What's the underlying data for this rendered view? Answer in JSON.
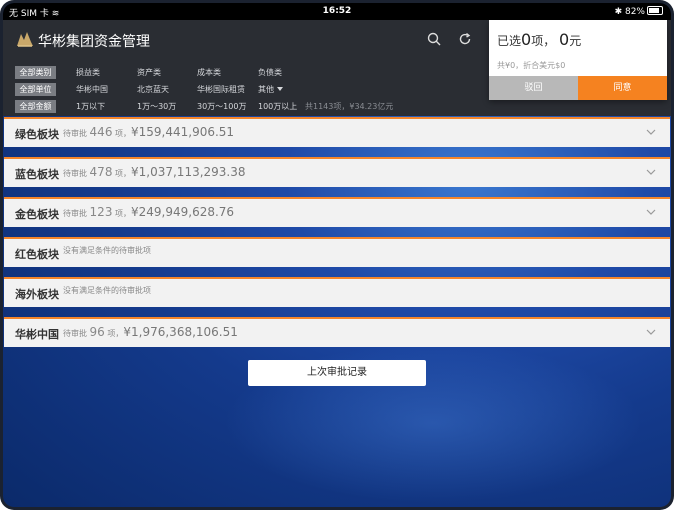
{
  "statusbar": {
    "carrier": "无 SIM 卡",
    "time": "16:52",
    "battery": "82%"
  },
  "header": {
    "title": "华彬集团资金管理"
  },
  "filters": {
    "row1": {
      "chip": "全部类别",
      "options": [
        "损益类",
        "资产类",
        "成本类",
        "负债类"
      ]
    },
    "row2": {
      "chip": "全部单位",
      "options": [
        "华彬中国",
        "北京蓝天",
        "华彬国际租赁",
        "其他"
      ]
    },
    "row3": {
      "chip": "全部金额",
      "options": [
        "1万以下",
        "1万～30万",
        "30万～100万",
        "100万以上"
      ],
      "summary": "共1143项，¥34.23亿元"
    }
  },
  "selection": {
    "prefix": "已选",
    "count": "0",
    "unit1": "项，",
    "amount": "0",
    "unit2": "元",
    "sub": "共¥0，折合美元$0",
    "reject": "驳回",
    "agree": "同意"
  },
  "sections": [
    {
      "name": "绿色板块",
      "label": "待审批",
      "count": "446",
      "unit": "项，",
      "amount": "¥159,441,906.51"
    },
    {
      "name": "蓝色板块",
      "label": "待审批",
      "count": "478",
      "unit": "项，",
      "amount": "¥1,037,113,293.38"
    },
    {
      "name": "金色板块",
      "label": "待审批",
      "count": "123",
      "unit": "项，",
      "amount": "¥249,949,628.76"
    },
    {
      "name": "红色板块",
      "note": "没有满足条件的待审批项"
    },
    {
      "name": "海外板块",
      "note": "没有满足条件的待审批项"
    },
    {
      "name": "华彬中国",
      "label": "待审批",
      "count": "96",
      "unit": "项，",
      "amount": "¥1,976,368,106.51"
    }
  ],
  "history_button": "上次审批记录"
}
